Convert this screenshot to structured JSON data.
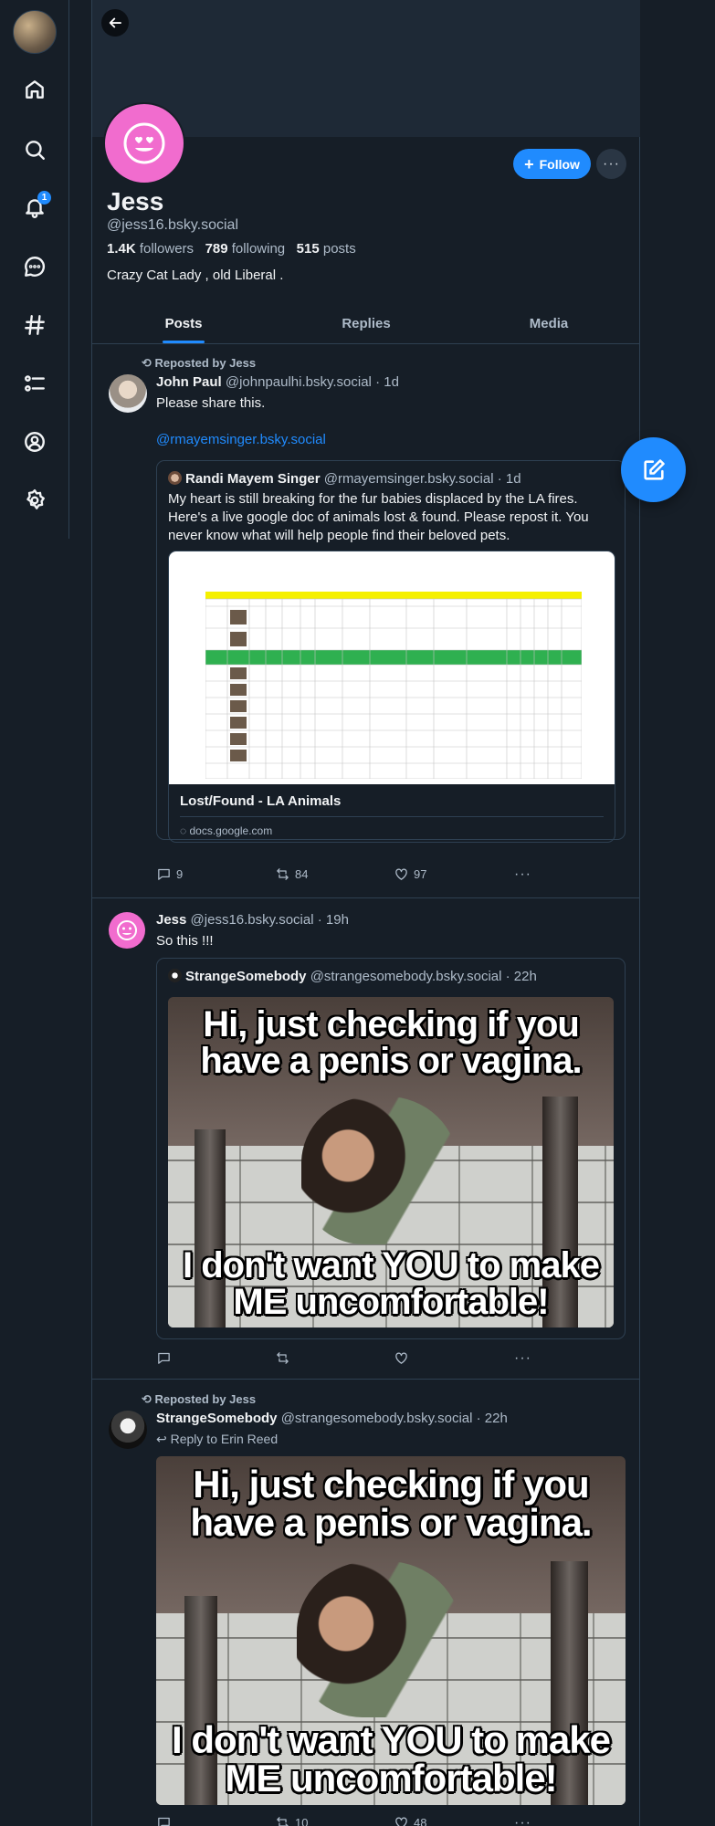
{
  "nav": {
    "notifications_badge": "1",
    "items": [
      "home-icon",
      "search-icon",
      "bell-icon",
      "chat-icon",
      "hashtag-icon",
      "lists-icon",
      "profile-icon",
      "settings-icon"
    ]
  },
  "profile": {
    "display_name": "Jess",
    "handle": "@jess16.bsky.social",
    "followers_count": "1.4K",
    "followers_label": "followers",
    "following_count": "789",
    "following_label": "following",
    "posts_count": "515",
    "posts_label": "posts",
    "bio": "Crazy Cat Lady ,  old Liberal .",
    "follow_label": "Follow",
    "more_label": "···"
  },
  "tabs": [
    {
      "label": "Posts",
      "active": true
    },
    {
      "label": "Replies",
      "active": false
    },
    {
      "label": "Media",
      "active": false
    }
  ],
  "posts": [
    {
      "repost_label": "Reposted by Jess",
      "author": "John Paul",
      "handle": "@johnpaulhi.bsky.social",
      "time": "· 1d",
      "text": "Please share this.",
      "mention": "@rmayemsinger.bsky.social",
      "quote": {
        "author": "Randi Mayem Singer",
        "handle": "@rmayemsinger.bsky.social",
        "time": "· 1d",
        "text": "My heart is still breaking for the fur babies displaced by the LA fires. Here's a live google doc of animals lost & found. Please repost it. You never know what will help people find their beloved pets.",
        "card_title": "Lost/Found - LA Animals",
        "card_domain": "docs.google.com"
      },
      "replies": "9",
      "reposts": "84",
      "likes": "97"
    },
    {
      "author": "Jess",
      "handle": "@jess16.bsky.social",
      "time": "· 19h",
      "text": "So this !!!",
      "quote": {
        "author": "StrangeSomebody",
        "handle": "@strangesomebody.bsky.social",
        "time": "· 22h",
        "meme_top": "Hi, just checking if you have a penis or vagina.",
        "meme_bottom": "I don't want YOU to make ME uncomfortable!"
      },
      "replies": "",
      "reposts": "",
      "likes": ""
    },
    {
      "repost_label": "Reposted by Jess",
      "author": "StrangeSomebody",
      "handle": "@strangesomebody.bsky.social",
      "time": "· 22h",
      "reply_to": "Reply to Erin Reed",
      "meme_top": "Hi, just checking if you have a penis or vagina.",
      "meme_bottom": "I don't want YOU to make ME uncomfortable!",
      "replies": "",
      "reposts": "10",
      "likes": "48"
    }
  ],
  "colors": {
    "background": "#161e27",
    "accent": "#208bfe",
    "avatar_pink": "#f16cce",
    "border": "#2e4052"
  }
}
